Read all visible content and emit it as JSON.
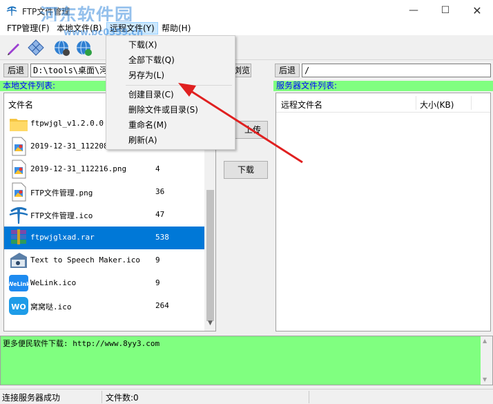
{
  "window": {
    "title": "FTP文件管理",
    "minimize": "—",
    "maximize": "☐",
    "close": "✕"
  },
  "watermark": {
    "text": "河东软件园",
    "url": "www.pc0359.cn"
  },
  "menubar": {
    "items": [
      {
        "label": "FTP管理(F)"
      },
      {
        "label": "本地文件(B)"
      },
      {
        "label": "远程文件(Y)"
      },
      {
        "label": "帮助(H)"
      }
    ]
  },
  "context_menu": {
    "items": [
      "下载(X)",
      "全部下载(Q)",
      "另存为(L)",
      "创建目录(C)",
      "删除文件或目录(S)",
      "重命名(M)",
      "刷新(A)"
    ]
  },
  "local": {
    "back_label": "后退",
    "path": "D:\\tools\\桌面\\河",
    "browse_label": "浏览",
    "list_label": "本地文件列表:",
    "col_name": "文件名",
    "files": [
      {
        "name": "ftpwjgl_v1.2.0.0",
        "size": "",
        "icon": "folder-icon"
      },
      {
        "name": "2019-12-31_112208.",
        "size": "",
        "icon": "png-file-icon"
      },
      {
        "name": "2019-12-31_112216.png",
        "size": "4",
        "icon": "png-file-icon"
      },
      {
        "name": "FTP文件管理.png",
        "size": "36",
        "icon": "png-file-icon"
      },
      {
        "name": "FTP文件管理.ico",
        "size": "47",
        "icon": "ftp-logo-icon"
      },
      {
        "name": "ftpwjglxad.rar",
        "size": "538",
        "icon": "rar-archive-icon"
      },
      {
        "name": "Text to Speech Maker.ico",
        "size": "9",
        "icon": "speech-maker-icon"
      },
      {
        "name": "WeLink.ico",
        "size": "9",
        "icon": "welink-icon"
      },
      {
        "name": "窝窝哒.ico",
        "size": "264",
        "icon": "wo-icon"
      }
    ]
  },
  "transfer": {
    "upload_label": "上传",
    "download_label": "下载"
  },
  "remote": {
    "back_label": "后退",
    "path": "/",
    "list_label": "服务器文件列表:",
    "col_name": "远程文件名",
    "col_size": "大小(KB)"
  },
  "log": {
    "text": "更多便民软件下载: http://www.8yy3.com"
  },
  "status": {
    "connection": "连接服务器成功",
    "file_count": "文件数:0"
  },
  "colors": {
    "green": "#80ff80",
    "selection": "#0078d7",
    "label_blue": "#0000ff",
    "arrow_red": "#e02020"
  }
}
